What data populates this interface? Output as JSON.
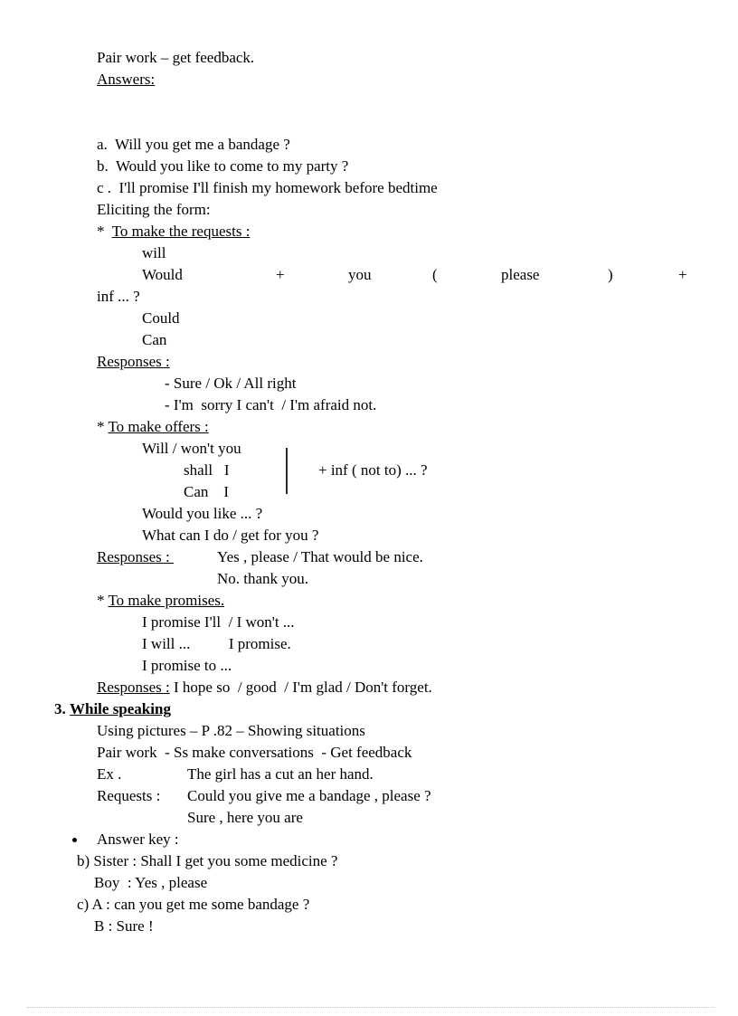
{
  "document": {
    "intro": {
      "pair_work": "Pair work – get feedback.",
      "answers_label": "Answers:"
    },
    "answers": [
      "a.  Will you get me a bandage ?",
      "b.  Would you like to come to my party ?",
      "c .  I'll promise I'll finish my homework before bedtime"
    ],
    "eliciting": {
      "heading": "Eliciting the form:",
      "requests": {
        "star": "*",
        "title": "To make the requests :",
        "modals_before": [
          "will"
        ],
        "pattern_row": {
          "w1": "Would",
          "w2": "+",
          "w3": "you",
          "w4": "(",
          "w5": "please",
          "w6": ")",
          "w7": "+"
        },
        "pattern_wrap": "inf ... ?",
        "modals_after": [
          "Could",
          "Can"
        ],
        "responses_label": "Responses :",
        "responses": [
          "- Sure / Ok / All right",
          "- I'm  sorry I can't  / I'm afraid not."
        ]
      },
      "offers": {
        "star": "*",
        "title": "To make offers :",
        "left_rows": [
          "Will / won't you",
          "shall   I",
          "Can    I"
        ],
        "right_text": "+ inf ( not to) ... ?",
        "extra_rows": [
          "Would you like ... ?",
          "What can I do / get for you ?"
        ],
        "responses_label": "Responses : ",
        "responses": [
          "Yes , please / That would be nice.",
          "No. thank you."
        ]
      },
      "promises": {
        "star": "*",
        "title": "To make promises.",
        "rows": [
          "I promise I'll  / I won't ...",
          "I will ...          I promise.",
          "I promise to ..."
        ],
        "responses_label": "Responses :",
        "responses_text": " I hope so  / good  / I'm glad / Don't forget."
      }
    },
    "while_speaking": {
      "number": "3.",
      "heading": "While speaking",
      "lines": [
        "Using pictures – P .82 – Showing situations",
        "Pair work  - Ss make conversations  - Get feedback"
      ],
      "example": {
        "label": "Ex .",
        "text": "The girl has a cut an her hand."
      },
      "requests": {
        "label": "Requests :",
        "text": "Could you give me a bandage , please ?",
        "reply": "Sure , here you are"
      },
      "answer_key_label": "Answer key :",
      "answer_key": [
        {
          "prompt": "b) Sister : Shall I get you some medicine ?",
          "reply": "Boy  : Yes , please"
        },
        {
          "prompt": "c) A : can you get me some bandage ?",
          "reply": "B : Sure !"
        }
      ]
    }
  }
}
